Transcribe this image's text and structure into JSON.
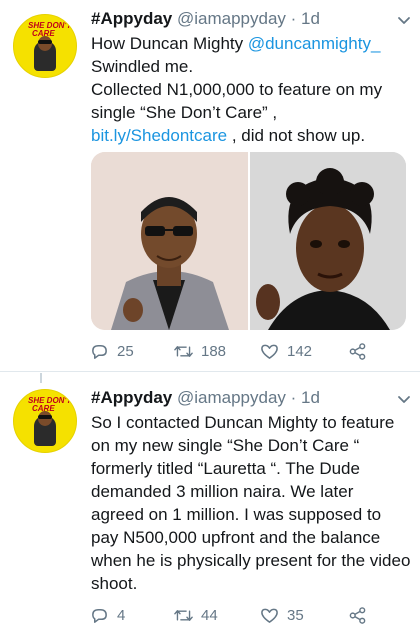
{
  "tweets": [
    {
      "name": "#Appyday",
      "handle": "@iamappyday",
      "time": "· 1d",
      "avatar_text": [
        "SHE DON'T",
        "CARE"
      ],
      "text_parts": [
        {
          "t": "How Duncan Mighty "
        },
        {
          "t": "@duncanmighty_",
          "link": true
        },
        {
          "t": "\nSwindled me.\nCollected N1,000,000 to feature on my single “She Don’t Care” , "
        },
        {
          "t": "bit.ly/Shedontcare",
          "link": true
        },
        {
          "t": " , did not show up."
        }
      ],
      "actions": {
        "replies": "25",
        "retweets": "188",
        "likes": "142"
      }
    },
    {
      "name": "#Appyday",
      "handle": "@iamappyday",
      "time": "· 1d",
      "avatar_text": [
        "SHE DON'T",
        "CARE"
      ],
      "text": "So I contacted Duncan Mighty to feature on my new single “She Don’t Care “ formerly titled “Lauretta “. The Dude demanded 3 million naira. We later agreed on 1 million. I was supposed to pay N500,000 upfront and the balance when he is physically present for the video shoot.",
      "actions": {
        "replies": "4",
        "retweets": "44",
        "likes": "35"
      }
    }
  ],
  "icons": [
    "chevron-down-icon",
    "reply-icon",
    "retweet-icon",
    "like-icon",
    "share-icon"
  ],
  "colors": {
    "link": "#1b95e0",
    "muted": "#657786",
    "avatar_bg": "#f5e100"
  }
}
